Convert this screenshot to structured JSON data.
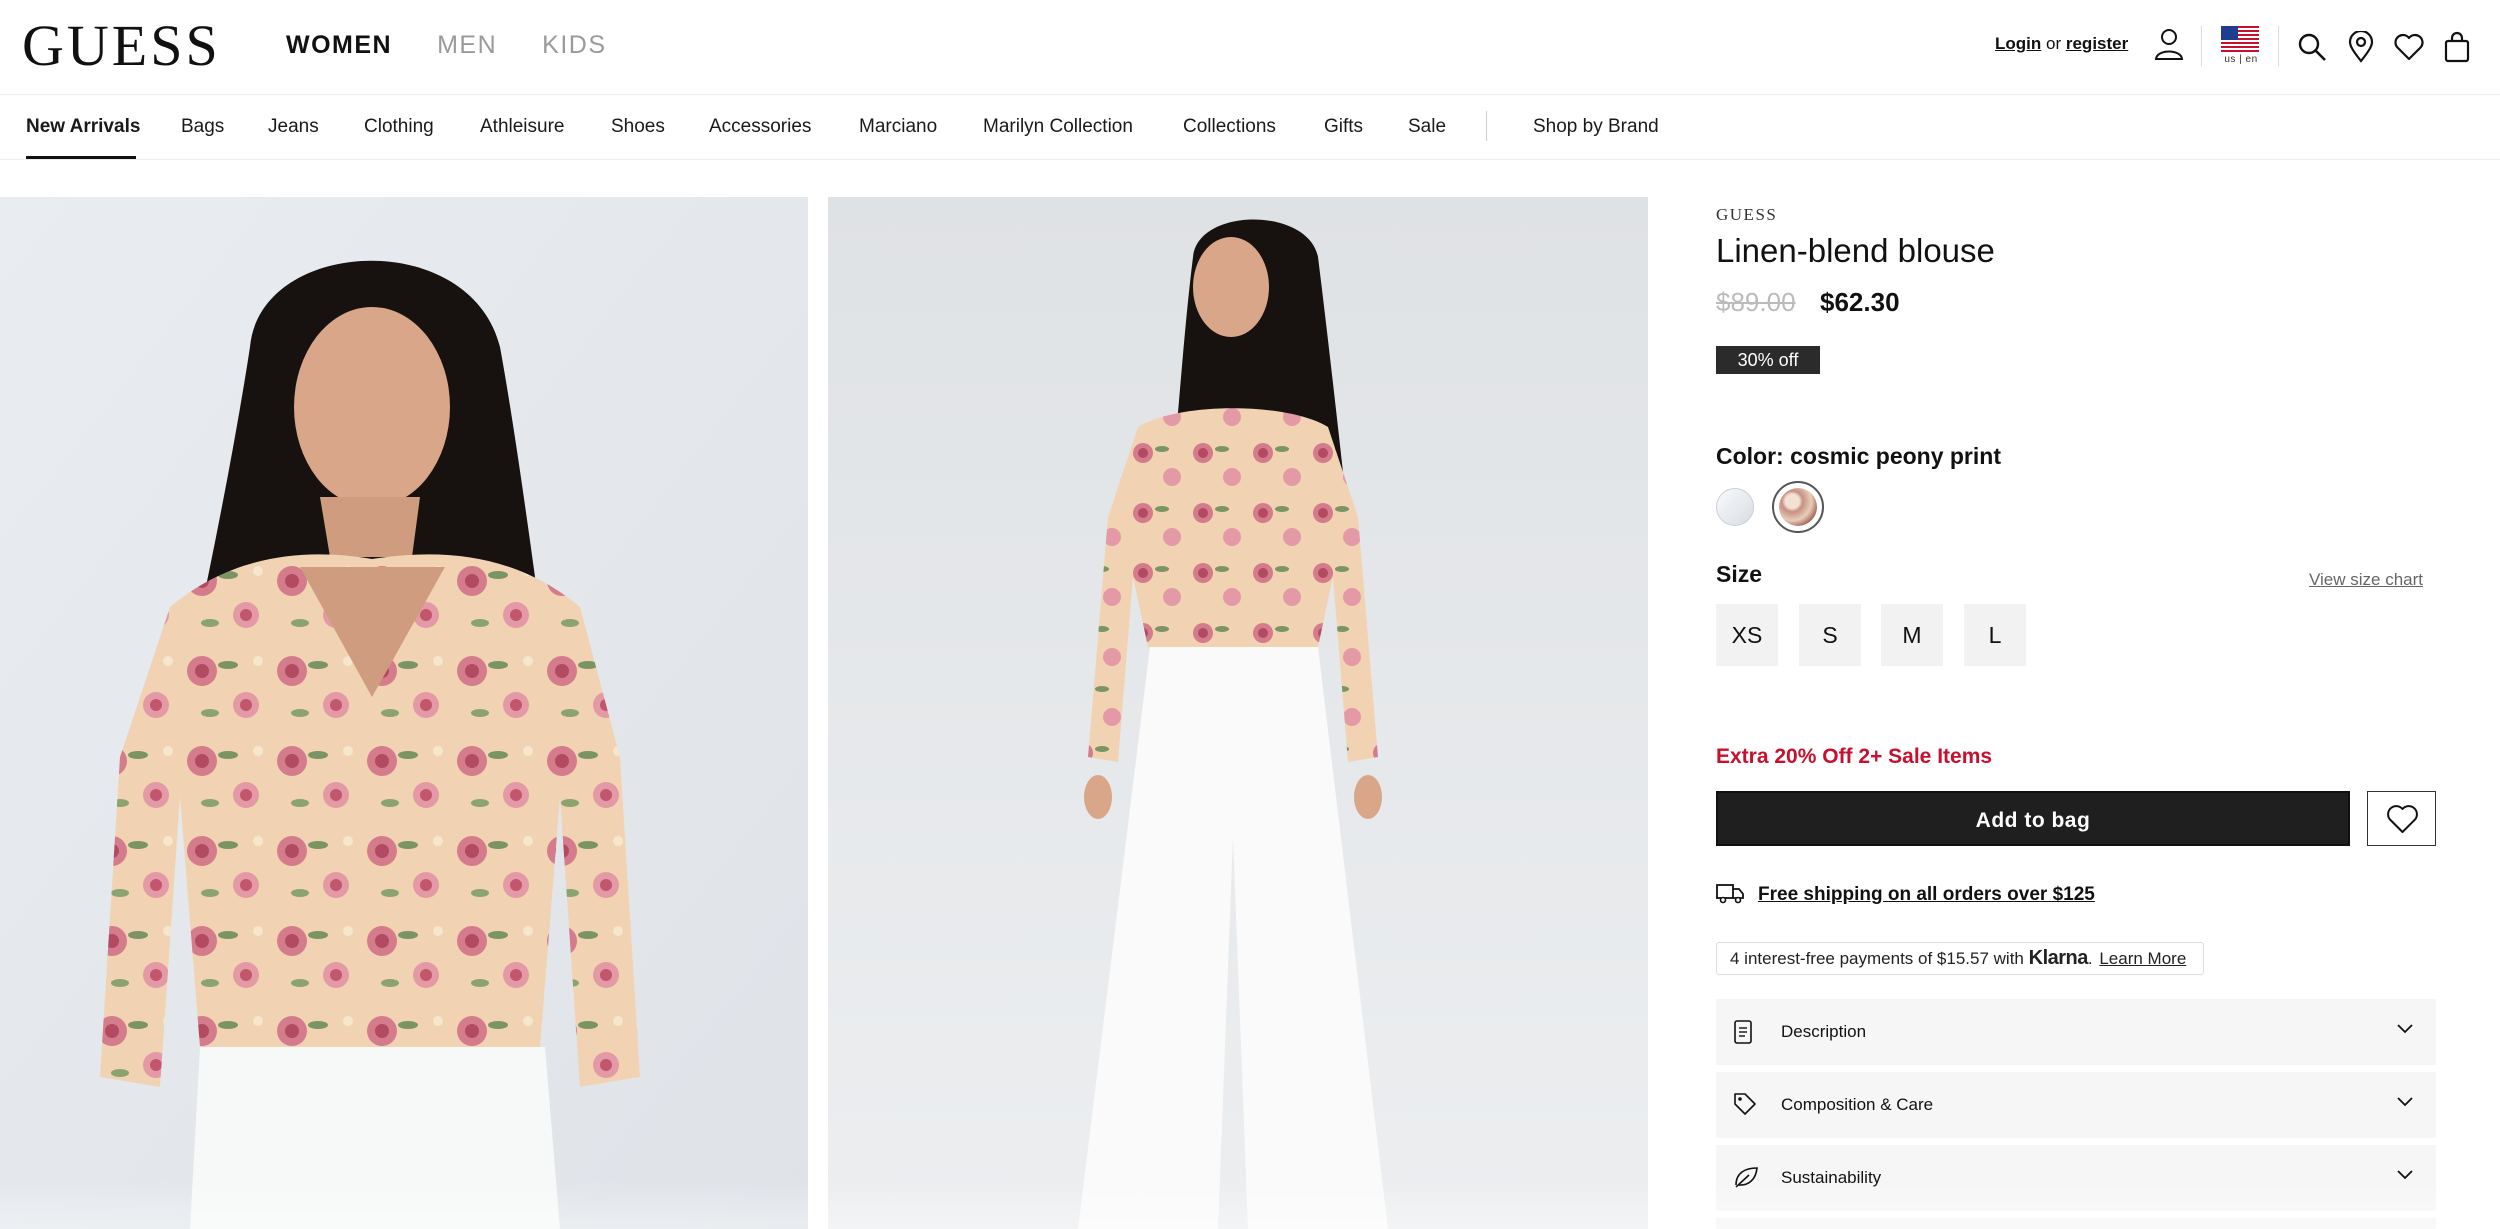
{
  "header": {
    "logo": "GUESS",
    "gender_tabs": [
      "WOMEN",
      "MEN",
      "KIDS"
    ],
    "active_gender": "WOMEN",
    "login_label": "Login",
    "or_label": "or",
    "register_label": "register",
    "locale_label": "us | en"
  },
  "category_nav": {
    "items": [
      "New Arrivals",
      "Bags",
      "Jeans",
      "Clothing",
      "Athleisure",
      "Shoes",
      "Accessories",
      "Marciano",
      "Marilyn Collection",
      "Collections",
      "Gifts",
      "Sale"
    ],
    "active": "New Arrivals",
    "shop_by_brand": "Shop by Brand"
  },
  "product": {
    "brand": "GUESS",
    "name": "Linen-blend blouse",
    "original_price": "$89.00",
    "sale_price": "$62.30",
    "discount_badge": "30% off",
    "color_label": "Color:",
    "color_value": "cosmic peony print",
    "swatches": [
      {
        "name": "white",
        "color": "#eef1f4"
      },
      {
        "name": "cosmic peony print",
        "color": "#d9b9a5",
        "selected": true
      }
    ],
    "size_label": "Size",
    "size_chart_link": "View size chart",
    "sizes": [
      "XS",
      "S",
      "M",
      "L"
    ],
    "promo": "Extra 20% Off 2+ Sale Items",
    "add_to_bag": "Add to bag",
    "shipping": "Free shipping on all orders over $125",
    "klarna": {
      "prefix": "4 interest-free payments of $15.57 with",
      "brand": "Klarna",
      "suffix": ".",
      "link": "Learn More"
    },
    "accordions": [
      "Description",
      "Composition & Care",
      "Sustainability"
    ]
  },
  "colors": {
    "promo_red": "#c8102e",
    "button_dark": "#1f1f1f",
    "badge_bg": "#2b2b2b",
    "price_muted": "#bbbbbb"
  }
}
